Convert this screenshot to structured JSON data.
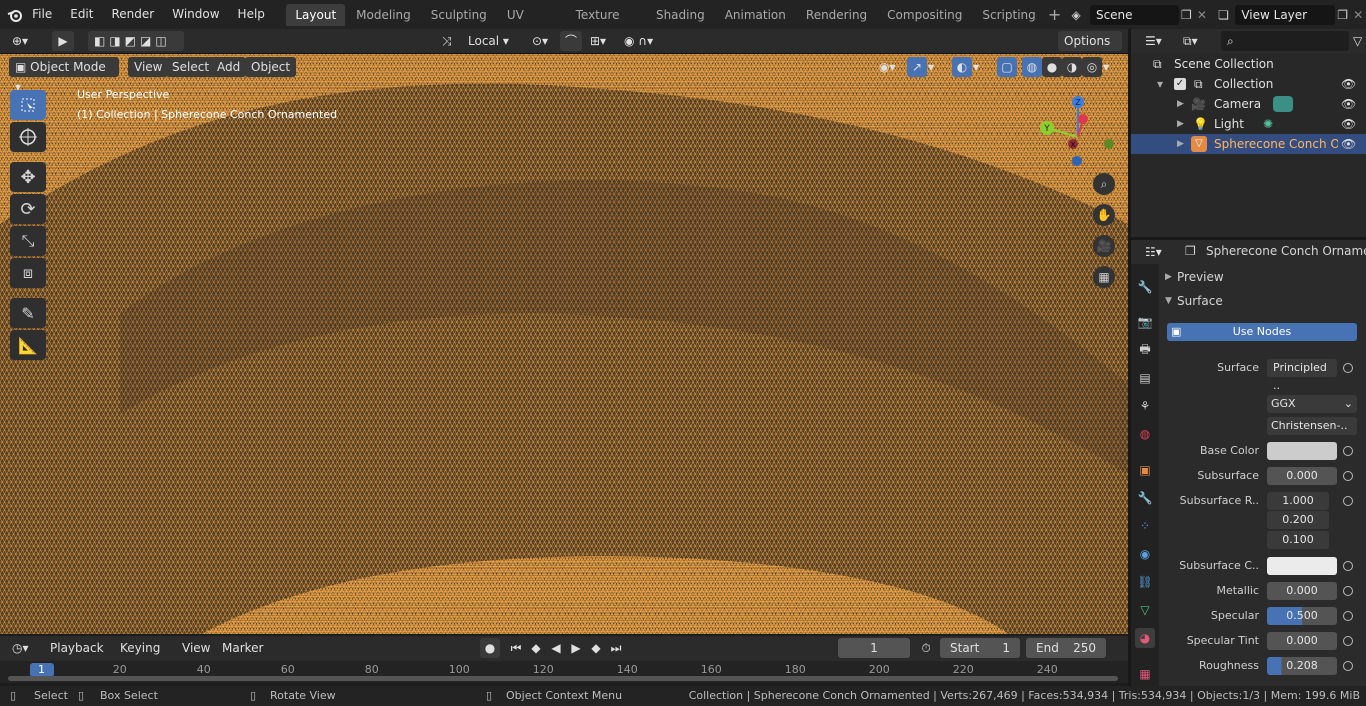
{
  "topbar": {
    "menus": [
      "File",
      "Edit",
      "Render",
      "Window",
      "Help"
    ],
    "workspaces": [
      "Layout",
      "Modeling",
      "Sculpting",
      "UV Editing",
      "Texture Paint",
      "Shading",
      "Animation",
      "Rendering",
      "Compositing",
      "Scripting"
    ],
    "active_workspace": "Layout",
    "scene": "Scene",
    "view_layer": "View Layer"
  },
  "viewport": {
    "mode": "Object Mode",
    "menus": [
      "View",
      "Select",
      "Add",
      "Object"
    ],
    "orientation": "Local",
    "options_label": "Options",
    "perspective_text": "User Perspective",
    "collection_text": "(1) Collection | Spherecone Conch Ornamented",
    "gizmo_labels": {
      "z": "Z",
      "y": "Y",
      "x": "X"
    },
    "wire_color": "#f0a040",
    "bg_color": "#3a3a3a"
  },
  "outliner": {
    "title": "Scene Collection",
    "rows": [
      {
        "label": "Collection",
        "kind": "collection"
      },
      {
        "label": "Camera",
        "kind": "camera"
      },
      {
        "label": "Light",
        "kind": "light"
      },
      {
        "label": "Spherecone Conch Ornar",
        "kind": "mesh"
      }
    ]
  },
  "properties": {
    "object_name": "Spherecone Conch Ornamented",
    "preview_label": "Preview",
    "surface_section": "Surface",
    "use_nodes_label": "Use Nodes",
    "surface_label": "Surface",
    "surface_value": "Principled ..",
    "distribution": "GGX",
    "subsurface_method": "Christensen-..",
    "rows": [
      {
        "label": "Base Color",
        "value": ""
      },
      {
        "label": "Subsurface",
        "value": "0.000"
      },
      {
        "label": "Subsurface R..",
        "value": "1.000"
      },
      {
        "label": "",
        "value": "0.200"
      },
      {
        "label": "",
        "value": "0.100"
      },
      {
        "label": "Subsurface C..",
        "value": ""
      },
      {
        "label": "Metallic",
        "value": "0.000"
      },
      {
        "label": "Specular",
        "value": "0.500"
      },
      {
        "label": "Specular Tint",
        "value": "0.000"
      },
      {
        "label": "Roughness",
        "value": "0.208"
      }
    ],
    "specular_fraction": 0.5,
    "roughness_fraction": 0.208
  },
  "timeline": {
    "menus": [
      "Playback",
      "Keying",
      "View",
      "Marker"
    ],
    "current_frame": "1",
    "start_label": "Start",
    "start_value": "1",
    "end_label": "End",
    "end_value": "250",
    "ruler": [
      "1",
      "20",
      "40",
      "60",
      "80",
      "100",
      "120",
      "140",
      "160",
      "180",
      "200",
      "220",
      "240"
    ]
  },
  "statusbar": {
    "select": "Select",
    "box_select": "Box Select",
    "rotate_view": "Rotate View",
    "context_menu": "Object Context Menu",
    "stats": "Collection | Spherecone Conch Ornamented | Verts:267,469 | Faces:534,934 | Tris:534,934 | Objects:1/3 | Mem: 199.6 MiB"
  }
}
